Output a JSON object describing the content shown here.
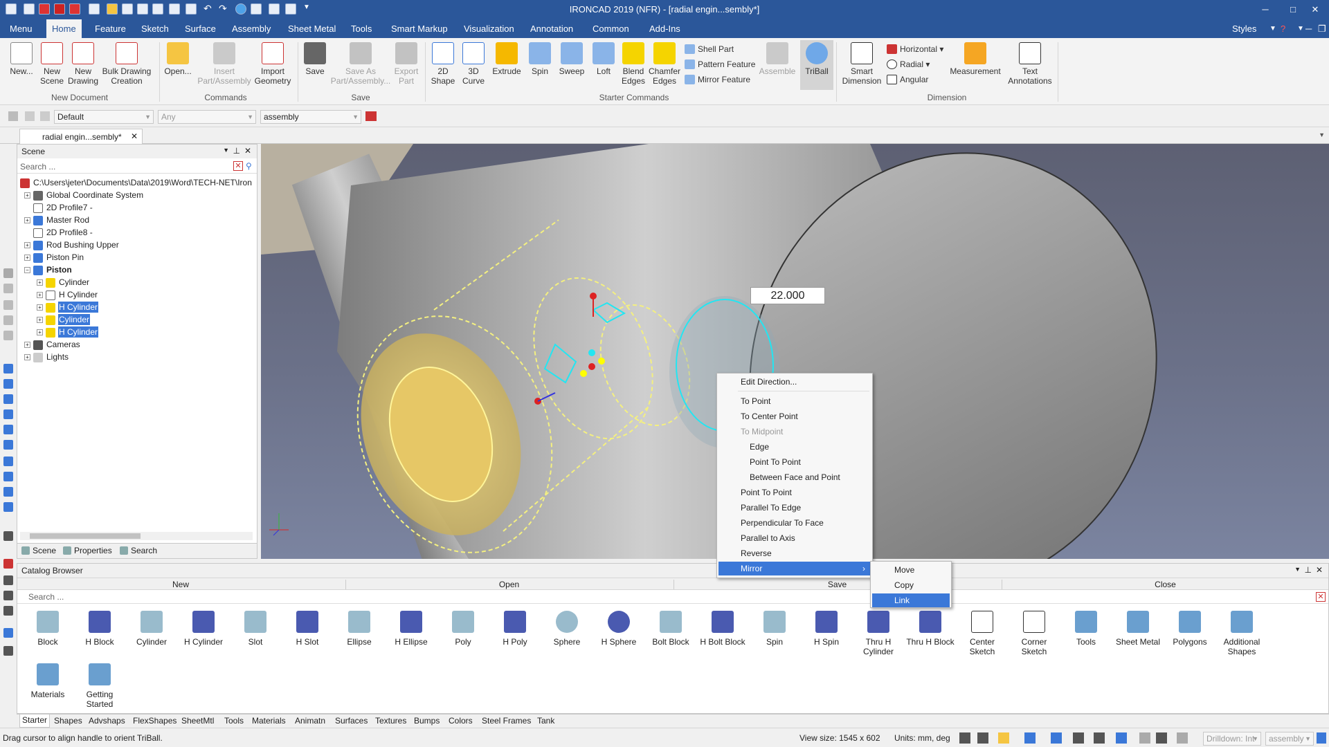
{
  "app": {
    "title": "IRONCAD 2019 (NFR) - [radial engin...sembly*]",
    "styles_label": "Styles"
  },
  "colors": {
    "title_bar": "#2b579a",
    "selection": "#3b78d8",
    "viewport_top": "#5d6073",
    "viewport_bottom": "#7b84a0"
  },
  "menu_tabs": [
    "Menu",
    "Home",
    "Feature",
    "Sketch",
    "Surface",
    "Assembly",
    "Sheet Metal",
    "Tools",
    "Smart Markup",
    "Visualization",
    "Annotation",
    "Common",
    "Add-Ins"
  ],
  "active_menu_tab": "Home",
  "ribbon": {
    "new_label": "New...",
    "new_scene": "New Scene",
    "new_drawing": "New Drawing",
    "bulk_drawing": "Bulk Drawing Creation",
    "group_new_document": "New Document",
    "open": "Open...",
    "insert_part": "Insert Part/Assembly",
    "import_geometry": "Import Geometry",
    "group_commands": "Commands",
    "save": "Save",
    "save_as": "Save As Part/Assembly...",
    "export_part": "Export Part",
    "group_save": "Save",
    "shape_2d": "2D Shape",
    "curve_3d": "3D Curve",
    "extrude": "Extrude",
    "spin": "Spin",
    "sweep": "Sweep",
    "loft": "Loft",
    "blend_edges": "Blend Edges",
    "chamfer_edges": "Chamfer Edges",
    "shell_part": "Shell Part",
    "pattern_feature": "Pattern Feature",
    "mirror_feature": "Mirror Feature",
    "assemble": "Assemble",
    "triball": "TriBall",
    "group_starter": "Starter Commands",
    "smart_dimension": "Smart Dimension",
    "horizontal": "Horizontal",
    "radial": "Radial",
    "angular": "Angular",
    "measurement": "Measurement",
    "text_annotations": "Text Annotations",
    "group_dimension": "Dimension"
  },
  "toolbar2": {
    "style_value": "Default",
    "filter_value": "Any",
    "level_value": "assembly"
  },
  "document_tab": "radial engin...sembly*",
  "scene": {
    "title": "Scene",
    "search_placeholder": "Search ...",
    "path": "C:\\Users\\jeter\\Documents\\Data\\2019\\Word\\TECH-NET\\Iron",
    "nodes": [
      "Global Coordinate System",
      "2D Profile7 -",
      "Master Rod",
      "2D Profile8 -",
      "Rod Bushing Upper",
      "Piston Pin",
      "Piston",
      "Cylinder",
      "H Cylinder",
      "H Cylinder",
      "Cylinder",
      "H Cylinder",
      "Cameras",
      "Lights"
    ],
    "tabs": [
      "Scene",
      "Properties",
      "Search"
    ]
  },
  "viewport": {
    "dimension_value": "22.000"
  },
  "context_menu": {
    "items": [
      "Edit Direction...",
      "To Point",
      "To Center Point",
      "To Midpoint",
      "Edge",
      "Point To Point",
      "Between Face and Point",
      "Point To Point",
      "Parallel To Edge",
      "Perpendicular To Face",
      "Parallel to Axis",
      "Reverse",
      "Mirror"
    ],
    "disabled": "To Midpoint",
    "highlighted": "Mirror",
    "submenu": [
      "Move",
      "Copy",
      "Link"
    ],
    "submenu_highlighted": "Link"
  },
  "catalog": {
    "title": "Catalog Browser",
    "buttons": [
      "New",
      "Open",
      "Save",
      "Close"
    ],
    "search_placeholder": "Search ...",
    "items": [
      "Block",
      "H Block",
      "Cylinder",
      "H Cylinder",
      "Slot",
      "H Slot",
      "Ellipse",
      "H Ellipse",
      "Poly",
      "H Poly",
      "Sphere",
      "H Sphere",
      "Bolt Block",
      "H Bolt Block",
      "Spin",
      "H Spin",
      "Thru H Cylinder",
      "Thru H Block",
      "Center Sketch",
      "Corner Sketch",
      "Tools",
      "Sheet Metal",
      "Polygons",
      "Additional Shapes",
      "Materials",
      "Getting Started"
    ],
    "tabs": [
      "Starter",
      "Shapes",
      "Advshaps",
      "FlexShapes",
      "SheetMtl",
      "Tools",
      "Materials",
      "Animatn",
      "Surfaces",
      "Textures",
      "Bumps",
      "Colors",
      "Steel Frames",
      "Tank"
    ]
  },
  "status": {
    "message": "Drag cursor to align handle to orient TriBall.",
    "view_size": "View size: 1545 x 602",
    "units": "Units: mm, deg",
    "drilldown": "Drilldown: Int",
    "assembly_combo": "assembly"
  }
}
